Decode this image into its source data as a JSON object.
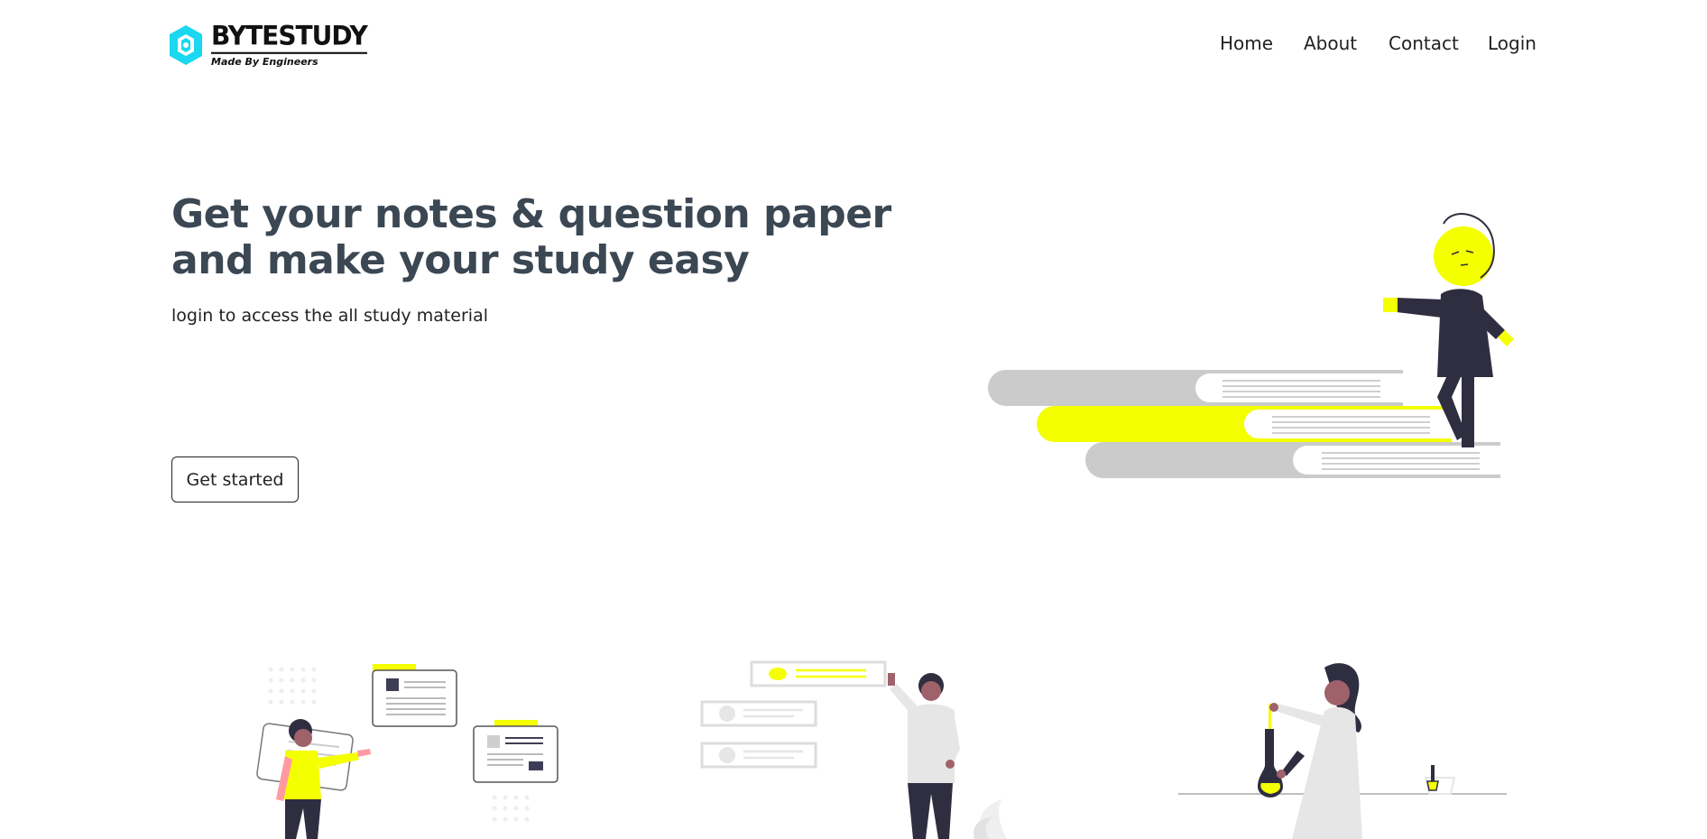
{
  "brand": {
    "name": "BYTESTUDY",
    "tagline": "Made By Engineers",
    "accent_color": "#19d8f0"
  },
  "nav": {
    "items": [
      "Home",
      "About",
      "Contact",
      "Login"
    ]
  },
  "hero": {
    "title_line1": "Get your notes & question paper",
    "title_line2": "and make your study easy",
    "subtitle": "login to access the all study material",
    "cta_label": "Get started"
  },
  "colors": {
    "heading": "#3b4753",
    "highlight": "#f4ff00",
    "figure_dark": "#2f2e41",
    "book_gray": "#cbcbcb"
  }
}
